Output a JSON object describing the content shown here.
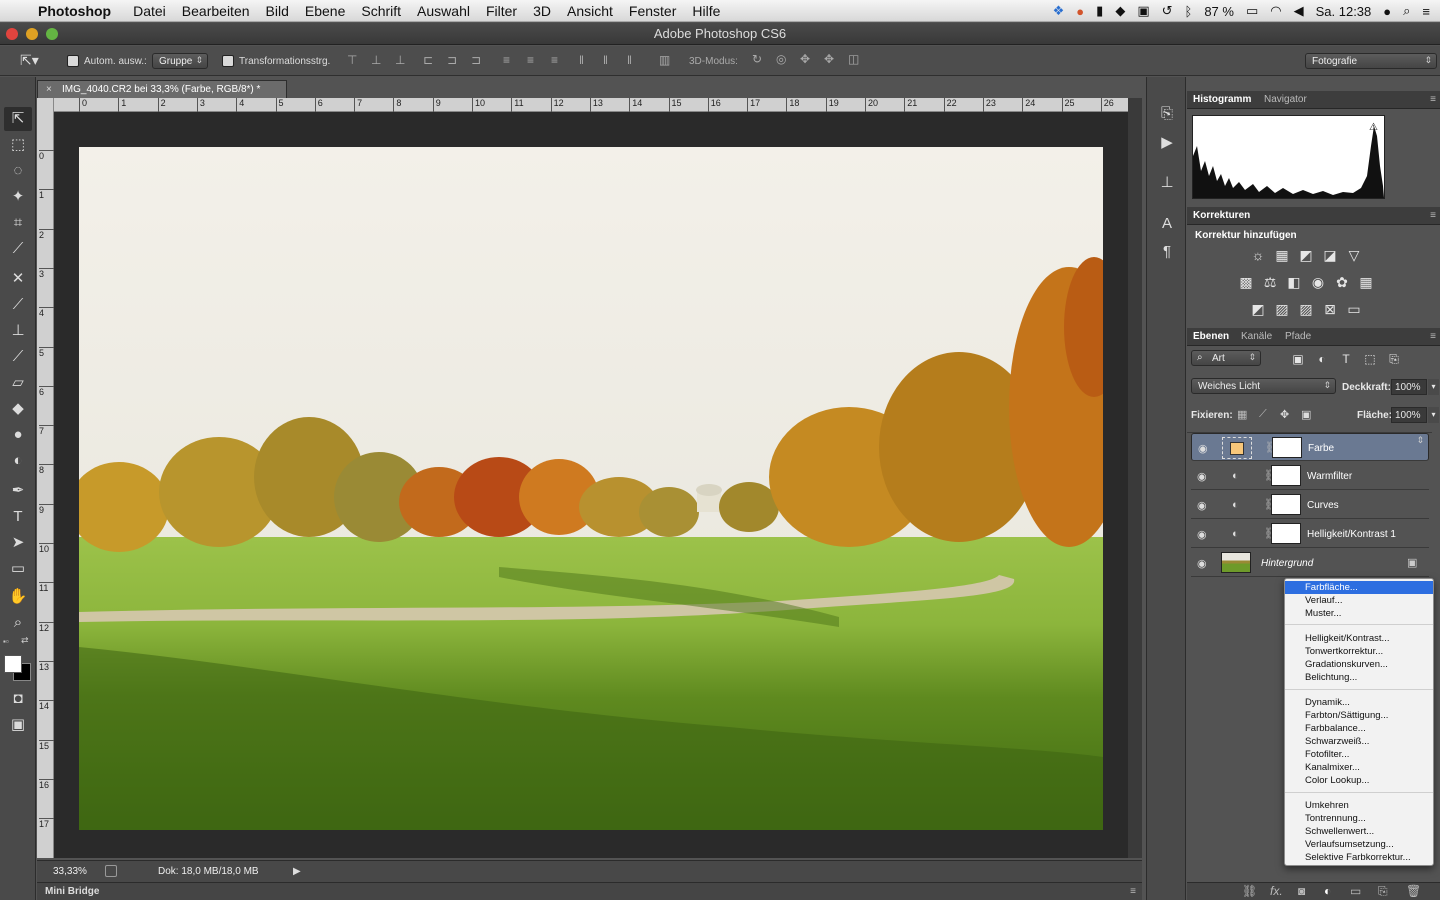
{
  "menubar": {
    "app": "Photoshop",
    "items": [
      "Datei",
      "Bearbeiten",
      "Bild",
      "Ebene",
      "Schrift",
      "Auswahl",
      "Filter",
      "3D",
      "Ansicht",
      "Fenster",
      "Hilfe"
    ],
    "battery": "87 %",
    "clock": "Sa. 12:38"
  },
  "window": {
    "title": "Adobe Photoshop CS6"
  },
  "options": {
    "autoselect_label": "Autom. ausw.:",
    "autoselect_value": "Gruppe",
    "transform_label": "Transformationsstrg.",
    "mode3d_label": "3D-Modus:",
    "workspace": "Fotografie"
  },
  "document": {
    "tab_title": "IMG_4040.CR2 bei 33,3% (Farbe, RGB/8*) *",
    "ruler_top": [
      "0",
      "1",
      "2",
      "3",
      "4",
      "5",
      "6",
      "7",
      "8",
      "9",
      "10",
      "11",
      "12",
      "13",
      "14",
      "15",
      "16",
      "17",
      "18",
      "19",
      "20",
      "21",
      "22",
      "23",
      "24",
      "25",
      "26"
    ],
    "ruler_left": [
      "0",
      "1",
      "2",
      "3",
      "4",
      "5",
      "6",
      "7",
      "8",
      "9",
      "10",
      "11",
      "12",
      "13",
      "14",
      "15",
      "16",
      "17"
    ],
    "zoom": "33,33%",
    "doc_info": "Dok: 18,0 MB/18,0 MB"
  },
  "minibridge": "Mini Bridge",
  "panels": {
    "histogram_tabs": [
      "Histogramm",
      "Navigator"
    ],
    "corrections_title": "Korrekturen",
    "corrections_add": "Korrektur hinzufügen",
    "layers_tabs": [
      "Ebenen",
      "Kanäle",
      "Pfade"
    ],
    "filter_kind": "Art",
    "blend_mode": "Weiches Licht",
    "opacity_label": "Deckkraft:",
    "opacity_value": "100%",
    "lock_label": "Fixieren:",
    "fill_label": "Fläche:",
    "fill_value": "100%",
    "layers": [
      {
        "name": "Farbe",
        "swatch": "#f7c77a"
      },
      {
        "name": "Warmfilter"
      },
      {
        "name": "Curves"
      },
      {
        "name": "Helligkeit/Kontrast 1"
      },
      {
        "name": "Hintergrund"
      }
    ]
  },
  "adjustment_menu": {
    "group1": [
      "Farbfläche...",
      "Verlauf...",
      "Muster..."
    ],
    "group2": [
      "Helligkeit/Kontrast...",
      "Tonwertkorrektur...",
      "Gradationskurven...",
      "Belichtung..."
    ],
    "group3": [
      "Dynamik...",
      "Farbton/Sättigung...",
      "Farbbalance...",
      "Schwarzweiß...",
      "Fotofilter...",
      "Kanalmixer...",
      "Color Lookup..."
    ],
    "group4": [
      "Umkehren",
      "Tontrennung...",
      "Schwellenwert...",
      "Verlaufsumsetzung...",
      "Selektive Farbkorrektur..."
    ]
  }
}
